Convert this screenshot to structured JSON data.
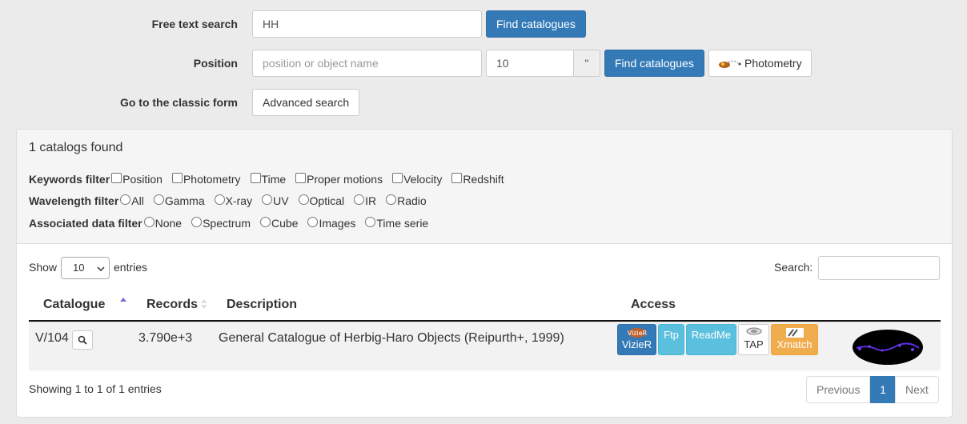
{
  "search": {
    "free_text_label": "Free text search",
    "free_text_value": "HH",
    "find_label": "Find catalogues",
    "position_label": "Position",
    "position_placeholder": "position or object name",
    "radius_value": "10",
    "radius_unit": "''",
    "find_label_2": "Find catalogues",
    "photometry_label": "Photometry",
    "classic_label": "Go to the classic form",
    "advanced_label": "Advanced search"
  },
  "results": {
    "found_text": "1 catalogs found",
    "keywords_filter_label": "Keywords filter",
    "keywords": [
      "Position",
      "Photometry",
      "Time",
      "Proper motions",
      "Velocity",
      "Redshift"
    ],
    "wavelength_filter_label": "Wavelength filter",
    "wavelengths": [
      "All",
      "Gamma",
      "X-ray",
      "UV",
      "Optical",
      "IR",
      "Radio"
    ],
    "assoc_filter_label": "Associated data filter",
    "assoc": [
      "None",
      "Spectrum",
      "Cube",
      "Images",
      "Time serie"
    ]
  },
  "table": {
    "show_label": "Show",
    "entries_value": "10",
    "entries_label": "entries",
    "search_label": "Search:",
    "headers": {
      "catalogue": "Catalogue",
      "records": "Records",
      "description": "Description",
      "access": "Access"
    },
    "rows": [
      {
        "catalogue": "V/104",
        "records": "3.790e+3",
        "description": "General Catalogue of Herbig-Haro Objects (Reipurth+, 1999)",
        "access": {
          "vizier": "VizieR",
          "ftp": "Ftp",
          "readme": "ReadMe",
          "tap": "TAP",
          "xmatch": "Xmatch"
        }
      }
    ],
    "info": "Showing 1 to 1 of 1 entries",
    "pagination": {
      "previous": "Previous",
      "page": "1",
      "next": "Next"
    }
  },
  "colors": {
    "primary": "#337ab7",
    "info": "#5bc0de",
    "warning": "#f0ad4e",
    "sort_asc": "#7b6bd6"
  }
}
